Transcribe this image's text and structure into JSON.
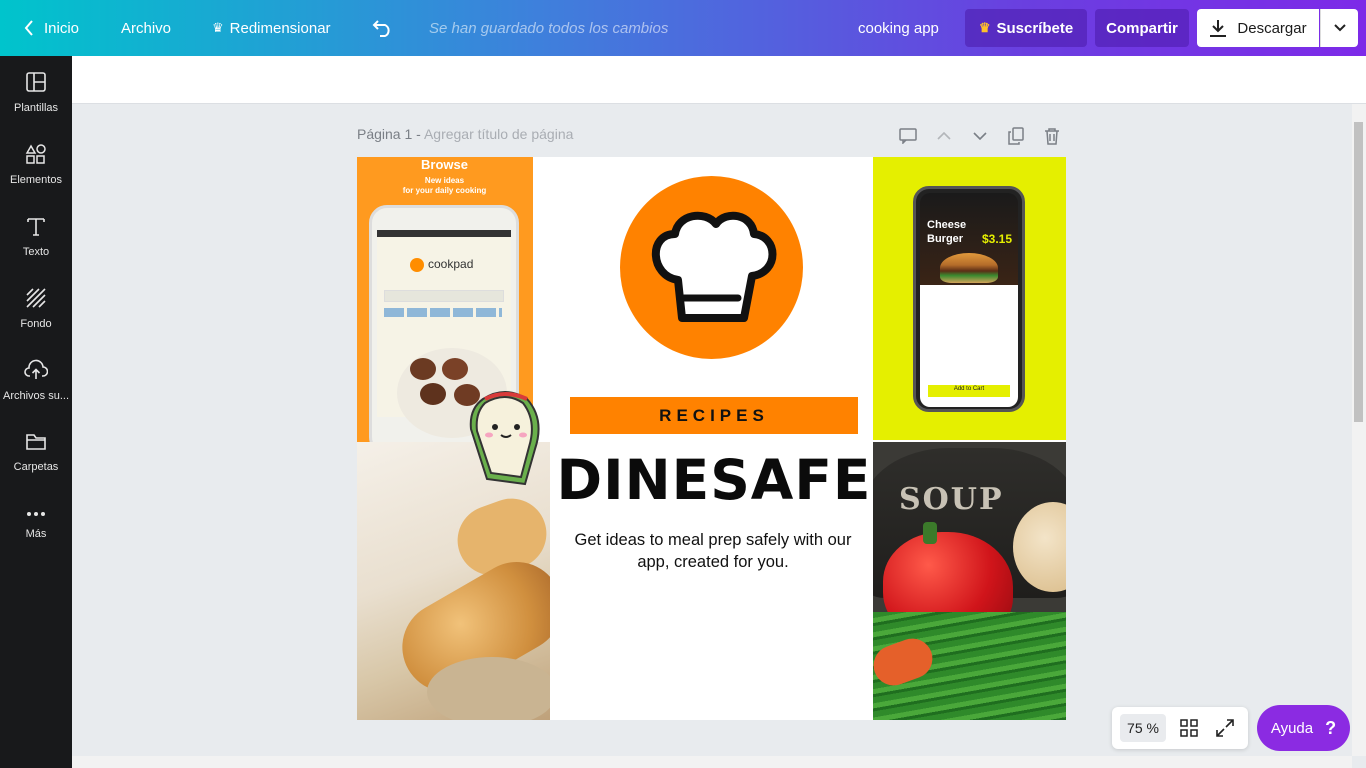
{
  "topbar": {
    "home_label": "Inicio",
    "file_label": "Archivo",
    "resize_label": "Redimensionar",
    "saved_status": "Se han guardado todos los cambios",
    "doc_title": "cooking app",
    "subscribe_label": "Suscríbete",
    "share_label": "Compartir",
    "download_label": "Descargar"
  },
  "sidebar": {
    "items": [
      {
        "label": "Plantillas",
        "icon": "templates-icon"
      },
      {
        "label": "Elementos",
        "icon": "elements-icon"
      },
      {
        "label": "Texto",
        "icon": "text-icon"
      },
      {
        "label": "Fondo",
        "icon": "background-icon"
      },
      {
        "label": "Archivos su...",
        "icon": "upload-icon"
      },
      {
        "label": "Carpetas",
        "icon": "folder-icon"
      },
      {
        "label": "Más",
        "icon": "more-icon"
      }
    ]
  },
  "page": {
    "label": "Página 1",
    "title_placeholder": "Agregar título de página"
  },
  "design": {
    "band_text": "RECIPES",
    "headline": "DINESAFE",
    "tagline": "Get ideas to meal prep safely with our app, created for you.",
    "phone_left": {
      "title": "Browse",
      "subtitle1": "New ideas",
      "subtitle2": "for your daily cooking",
      "brand": "cookpad"
    },
    "phone_right": {
      "item_name_1": "Cheese",
      "item_name_2": "Burger",
      "price": "$3.15",
      "button": "Add to Cart"
    },
    "soup_text": "SOUP"
  },
  "zoom": {
    "value": "75 %"
  },
  "help": {
    "label": "Ayuda",
    "glyph": "?"
  },
  "colors": {
    "accent_orange": "#ff8200",
    "accent_purple": "#7d2ae8",
    "lime": "#e5ef00",
    "sidebar_bg": "#18191b"
  }
}
